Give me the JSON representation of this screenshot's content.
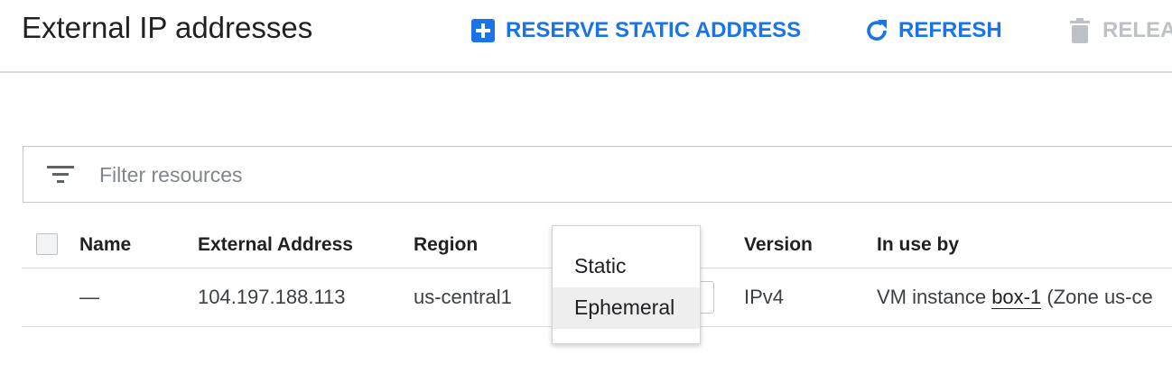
{
  "header": {
    "title": "External IP addresses",
    "reserve_label": "RESERVE STATIC ADDRESS",
    "refresh_label": "REFRESH",
    "release_label": "RELEA"
  },
  "filter": {
    "placeholder": "Filter resources"
  },
  "table": {
    "columns": {
      "name": "Name",
      "external_address": "External Address",
      "region": "Region",
      "version": "Version",
      "in_use_by": "In use by"
    },
    "rows": [
      {
        "name": "—",
        "external_address": "104.197.188.113",
        "region": "us-central1",
        "version": "IPv4",
        "in_use_prefix": "VM instance",
        "in_use_link": "box-1",
        "in_use_suffix": "(Zone us-ce"
      }
    ]
  },
  "type_menu": {
    "options": [
      "Static",
      "Ephemeral"
    ],
    "selected": "Ephemeral"
  },
  "icons": {
    "reserve": "add-box-icon",
    "refresh": "refresh-icon",
    "release": "trash-icon",
    "filter": "filter-list-icon"
  },
  "colors": {
    "accent": "#1a73e8",
    "disabled": "#bdc1c6"
  }
}
